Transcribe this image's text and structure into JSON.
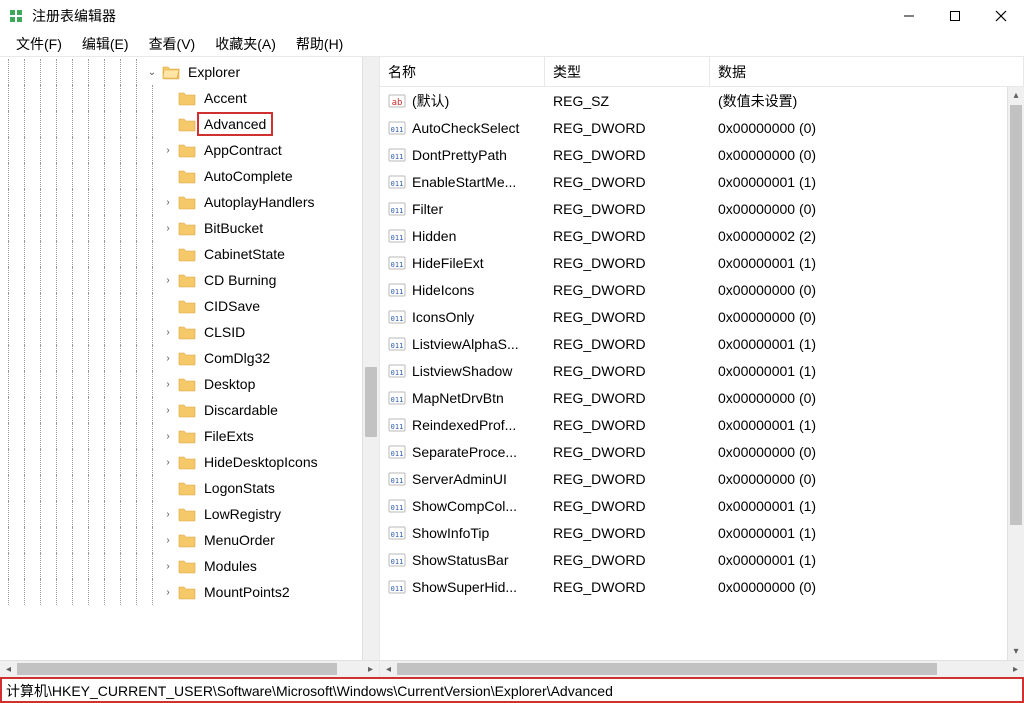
{
  "window": {
    "title": "注册表编辑器"
  },
  "menu": {
    "file": "文件(F)",
    "edit": "编辑(E)",
    "view": "查看(V)",
    "favorites": "收藏夹(A)",
    "help": "帮助(H)"
  },
  "tree": {
    "root": "Explorer",
    "selected": "Advanced",
    "items": [
      {
        "label": "Accent",
        "expander": "none"
      },
      {
        "label": "Advanced",
        "expander": "none",
        "selected": true
      },
      {
        "label": "AppContract",
        "expander": "closed"
      },
      {
        "label": "AutoComplete",
        "expander": "none"
      },
      {
        "label": "AutoplayHandlers",
        "expander": "closed"
      },
      {
        "label": "BitBucket",
        "expander": "closed"
      },
      {
        "label": "CabinetState",
        "expander": "none"
      },
      {
        "label": "CD Burning",
        "expander": "closed"
      },
      {
        "label": "CIDSave",
        "expander": "none"
      },
      {
        "label": "CLSID",
        "expander": "closed"
      },
      {
        "label": "ComDlg32",
        "expander": "closed"
      },
      {
        "label": "Desktop",
        "expander": "closed"
      },
      {
        "label": "Discardable",
        "expander": "closed"
      },
      {
        "label": "FileExts",
        "expander": "closed"
      },
      {
        "label": "HideDesktopIcons",
        "expander": "closed"
      },
      {
        "label": "LogonStats",
        "expander": "none"
      },
      {
        "label": "LowRegistry",
        "expander": "closed"
      },
      {
        "label": "MenuOrder",
        "expander": "closed"
      },
      {
        "label": "Modules",
        "expander": "closed"
      },
      {
        "label": "MountPoints2",
        "expander": "closed"
      }
    ]
  },
  "list": {
    "headers": {
      "name": "名称",
      "type": "类型",
      "data": "数据"
    },
    "rows": [
      {
        "icon": "string",
        "name": "(默认)",
        "type": "REG_SZ",
        "data": "(数值未设置)"
      },
      {
        "icon": "binary",
        "name": "AutoCheckSelect",
        "type": "REG_DWORD",
        "data": "0x00000000 (0)"
      },
      {
        "icon": "binary",
        "name": "DontPrettyPath",
        "type": "REG_DWORD",
        "data": "0x00000000 (0)"
      },
      {
        "icon": "binary",
        "name": "EnableStartMe...",
        "type": "REG_DWORD",
        "data": "0x00000001 (1)"
      },
      {
        "icon": "binary",
        "name": "Filter",
        "type": "REG_DWORD",
        "data": "0x00000000 (0)"
      },
      {
        "icon": "binary",
        "name": "Hidden",
        "type": "REG_DWORD",
        "data": "0x00000002 (2)"
      },
      {
        "icon": "binary",
        "name": "HideFileExt",
        "type": "REG_DWORD",
        "data": "0x00000001 (1)"
      },
      {
        "icon": "binary",
        "name": "HideIcons",
        "type": "REG_DWORD",
        "data": "0x00000000 (0)"
      },
      {
        "icon": "binary",
        "name": "IconsOnly",
        "type": "REG_DWORD",
        "data": "0x00000000 (0)"
      },
      {
        "icon": "binary",
        "name": "ListviewAlphaS...",
        "type": "REG_DWORD",
        "data": "0x00000001 (1)"
      },
      {
        "icon": "binary",
        "name": "ListviewShadow",
        "type": "REG_DWORD",
        "data": "0x00000001 (1)"
      },
      {
        "icon": "binary",
        "name": "MapNetDrvBtn",
        "type": "REG_DWORD",
        "data": "0x00000000 (0)"
      },
      {
        "icon": "binary",
        "name": "ReindexedProf...",
        "type": "REG_DWORD",
        "data": "0x00000001 (1)"
      },
      {
        "icon": "binary",
        "name": "SeparateProce...",
        "type": "REG_DWORD",
        "data": "0x00000000 (0)"
      },
      {
        "icon": "binary",
        "name": "ServerAdminUI",
        "type": "REG_DWORD",
        "data": "0x00000000 (0)"
      },
      {
        "icon": "binary",
        "name": "ShowCompCol...",
        "type": "REG_DWORD",
        "data": "0x00000001 (1)"
      },
      {
        "icon": "binary",
        "name": "ShowInfoTip",
        "type": "REG_DWORD",
        "data": "0x00000001 (1)"
      },
      {
        "icon": "binary",
        "name": "ShowStatusBar",
        "type": "REG_DWORD",
        "data": "0x00000001 (1)"
      },
      {
        "icon": "binary",
        "name": "ShowSuperHid...",
        "type": "REG_DWORD",
        "data": "0x00000000 (0)"
      }
    ]
  },
  "statusbar": {
    "path": "计算机\\HKEY_CURRENT_USER\\Software\\Microsoft\\Windows\\CurrentVersion\\Explorer\\Advanced"
  }
}
